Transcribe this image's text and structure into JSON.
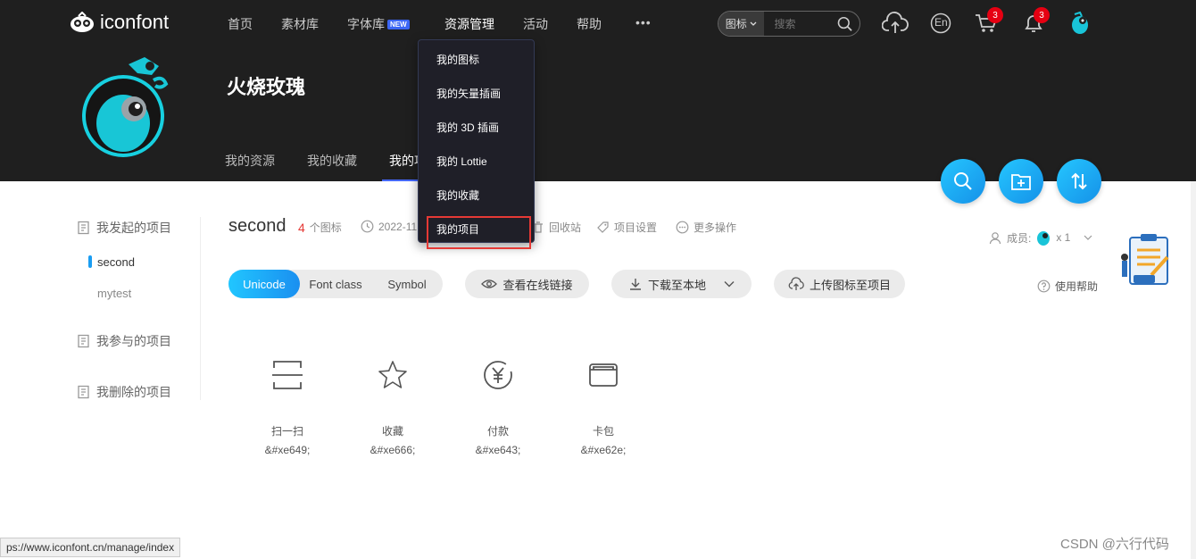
{
  "header": {
    "logo_text": "iconfont",
    "nav": [
      {
        "label": "首页"
      },
      {
        "label": "素材库"
      },
      {
        "label": "字体库",
        "badge": "NEW"
      },
      {
        "label": "资源管理"
      },
      {
        "label": "活动"
      },
      {
        "label": "帮助"
      },
      {
        "label": "•••"
      }
    ],
    "search": {
      "scope": "图标",
      "placeholder": "搜索"
    },
    "cart_count": "3",
    "notify_count": "3",
    "lang_label": "En"
  },
  "profile": {
    "username": "火烧玫瑰",
    "tabs": [
      {
        "label": "我的资源"
      },
      {
        "label": "我的收藏"
      },
      {
        "label": "我的项"
      }
    ]
  },
  "dropdown": {
    "items": [
      {
        "label": "我的图标"
      },
      {
        "label": "我的矢量插画"
      },
      {
        "label": "我的 3D 插画"
      },
      {
        "label": "我的 Lottie"
      },
      {
        "label": "我的收藏"
      },
      {
        "label": "我的项目"
      }
    ]
  },
  "sidebar": {
    "initiated": "我发起的项目",
    "projects": [
      {
        "label": "second"
      },
      {
        "label": "mytest"
      }
    ],
    "participated": "我参与的项目",
    "deleted": "我删除的项目"
  },
  "project": {
    "title": "second",
    "icon_count": "4",
    "icon_count_unit": "个图标",
    "date": "2022-11",
    "trash": "回收站",
    "settings": "项目设置",
    "more": "更多操作",
    "members_label": "成员:",
    "members_count": "x 1",
    "help": "使用帮助"
  },
  "toolbar": {
    "segments": [
      {
        "label": "Unicode",
        "active": true
      },
      {
        "label": "Font class"
      },
      {
        "label": "Symbol"
      }
    ],
    "view_link": "查看在线链接",
    "download": "下载至本地",
    "upload": "上传图标至项目"
  },
  "icons": [
    {
      "name": "扫一扫",
      "code": "&#xe649;",
      "icon": "scan-icon"
    },
    {
      "name": "收藏",
      "code": "&#xe666;",
      "icon": "star-icon"
    },
    {
      "name": "付款",
      "code": "&#xe643;",
      "icon": "yen-icon"
    },
    {
      "name": "卡包",
      "code": "&#xe62e;",
      "icon": "card-icon"
    }
  ],
  "status_url": "ps://www.iconfont.cn/manage/index",
  "watermark": "CSDN @六行代码",
  "colors": {
    "accent": "#1a9df2",
    "header_bg": "#1f1f1f",
    "badge_red": "#e60012",
    "highlight_red": "#e53935"
  }
}
